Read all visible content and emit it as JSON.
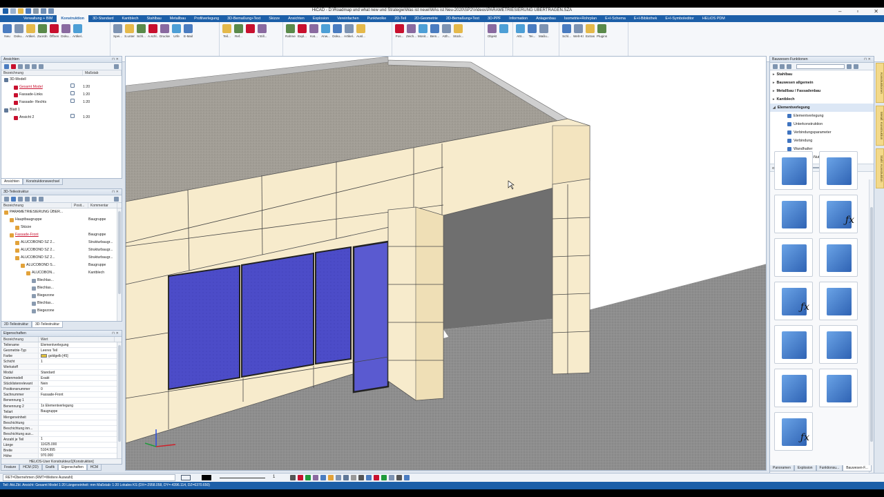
{
  "app": {
    "title": "HiCAD - D:\\Roadmap und what new und Strategie\\Was ist neue\\WAs ist Neu-2020\\SP2\\Videos\\PARAMETRIESIERUNG ÜBERTRAGEN.SZA",
    "accent": "#1c5fa8"
  },
  "menu_tabs": [
    "Verwaltung + BIM",
    "Konstruktion",
    "3D-Standard",
    "Kantblech",
    "Stahlbau",
    "Metallbau",
    "Profilverlegung",
    "3D-Bemaßung+Text",
    "Skizze",
    "Ansichten",
    "Explosion",
    "Vereinfachen",
    "Punktwolke",
    "2D-Teil",
    "2D-Geometrie",
    "2D-Bemaßung+Text",
    "3D-PPF",
    "Information",
    "Anlagenbau",
    "Isometrie+Rohrplan",
    "E+I-Schema",
    "E+I-Bibliothek",
    "E+I-Symboleditor",
    "HELiOS PDM"
  ],
  "active_tab": "Konstruktion",
  "ribbon_groups": [
    {
      "name": "Neu/Öffnen",
      "buttons": [
        "Neu",
        "Doku...",
        "Artikel...",
        "Zuordn...",
        "Öffnen",
        "Doku...",
        "Artikel..."
      ]
    },
    {
      "name": "Speichern/Drucken",
      "buttons": [
        "Spei...",
        "S.unter",
        "Schl...",
        "A.schl...",
        "Drucken",
        "Urfe",
        "E-Mail"
      ]
    },
    {
      "name": "Speichern/Referenzieren",
      "buttons": [
        "Teil...",
        "Ref...",
        "",
        "V.Eill..."
      ]
    },
    {
      "name": "Teil einfügen",
      "buttons": [
        "Rahmen",
        "Expl...",
        "Kat...",
        "Anw...",
        "Doku...",
        "Artikel...",
        "Ausl..."
      ]
    },
    {
      "name": "Positionierung/Detaillierung",
      "buttons": [
        "Pos...",
        "Zeich...",
        "Monit...",
        "Bem...",
        "Atth...",
        "Stück..."
      ]
    },
    {
      "name": "Löschen",
      "buttons": [
        "Objekt",
        ""
      ]
    },
    {
      "name": "Eigenschaften",
      "buttons": [
        "Attr...",
        "Tei...",
        "Maßu..."
      ]
    },
    {
      "name": "Sonstiges",
      "buttons": [
        "Schl...",
        "Welt-KS",
        "Extras",
        "Plugins"
      ]
    }
  ],
  "views_panel": {
    "title": "Ansichten",
    "columns": [
      "Bezeichnung",
      "Maßstab"
    ],
    "rows": [
      {
        "name": "3D-Modell",
        "scale": "",
        "level": 0,
        "red": false
      },
      {
        "name": "Gesamt Model",
        "scale": "1:20",
        "level": 1,
        "red": true
      },
      {
        "name": "Fassade-Links",
        "scale": "1:20",
        "level": 1,
        "red": false
      },
      {
        "name": "Fassade- Rechts",
        "scale": "1:20",
        "level": 1,
        "red": false
      },
      {
        "name": "Blatt 1",
        "scale": "",
        "level": 0,
        "red": false
      },
      {
        "name": "Ansicht 2",
        "scale": "1:20",
        "level": 1,
        "red": false
      }
    ],
    "tabs": [
      "Ansichten",
      "Konstruktionswechsel"
    ]
  },
  "structure_panel": {
    "title": "3D-Teilestruktur",
    "columns": [
      "Bezeichnung",
      "Posit...",
      "Kommentar"
    ],
    "rows": [
      {
        "name": "PARAMETRIESIERUNG ÜBER...",
        "comment": "",
        "level": 0,
        "red": false
      },
      {
        "name": "Hauptbaugruppe",
        "comment": "Baugruppe",
        "level": 1,
        "red": false
      },
      {
        "name": "Skizze",
        "comment": "",
        "level": 2,
        "red": false
      },
      {
        "name": "Fassade-Front",
        "comment": "Baugruppe",
        "level": 1,
        "red": true
      },
      {
        "name": "ALUCOBOND SZ 2...",
        "comment": "Strukturbaugr...",
        "level": 2,
        "red": false
      },
      {
        "name": "ALUCOBOND SZ 2...",
        "comment": "Strukturbaugr...",
        "level": 2,
        "red": false
      },
      {
        "name": "ALUCOBOND SZ 2...",
        "comment": "Strukturbaugr...",
        "level": 2,
        "red": false
      },
      {
        "name": "ALUCOBOND S...",
        "comment": "Baugruppe",
        "level": 3,
        "red": false
      },
      {
        "name": "ALUCOBON...",
        "comment": "Kantblech",
        "level": 4,
        "red": false
      },
      {
        "name": "Blechlas...",
        "comment": "",
        "level": 5,
        "red": false
      },
      {
        "name": "Blechlas...",
        "comment": "",
        "level": 5,
        "red": false
      },
      {
        "name": "Biegezone",
        "comment": "",
        "level": 5,
        "red": false
      },
      {
        "name": "Blechlas...",
        "comment": "",
        "level": 5,
        "red": false
      },
      {
        "name": "Biegezone",
        "comment": "",
        "level": 5,
        "red": false
      }
    ],
    "tabs": [
      "2D-Teilestruktur",
      "3D-Teilestruktur"
    ]
  },
  "properties_panel": {
    "title": "Eigenschaften",
    "columns": [
      "Bezeichnung",
      "Wert"
    ],
    "rows": [
      {
        "k": "Teilename",
        "v": "Elementverlegung"
      },
      {
        "k": "Geometrie-Typ",
        "v": "Leeres Teil"
      },
      {
        "k": "Farbe",
        "v": "goldgelb [45]",
        "swatch": "#e2c23a"
      },
      {
        "k": "Schicht",
        "v": "1"
      },
      {
        "k": "Werkstoff",
        "v": ""
      },
      {
        "k": "Modul",
        "v": "Standard"
      },
      {
        "k": "Datenmodell",
        "v": "Exakt"
      },
      {
        "k": "Stücklistenrelevant",
        "v": "Nein"
      },
      {
        "k": "Positionsnummer",
        "v": "0"
      },
      {
        "k": "Sachnummer",
        "v": "Fassade-Front"
      },
      {
        "k": "Benennung 1",
        "v": ""
      },
      {
        "k": "Benennung 2",
        "v": "1x Elementverlegung"
      },
      {
        "k": "Teilart",
        "v": "Baugruppe"
      },
      {
        "k": "Mengeneinheit",
        "v": ""
      },
      {
        "k": "Beschichtung",
        "v": ""
      },
      {
        "k": "Beschichtung inn...",
        "v": ""
      },
      {
        "k": "Beschichtung aus...",
        "v": ""
      },
      {
        "k": "Anzahl je Teil",
        "v": "1"
      },
      {
        "k": "Länge",
        "v": "11625.000"
      },
      {
        "k": "Breite",
        "v": "5104.995"
      },
      {
        "k": "Höhe",
        "v": "970.000"
      }
    ],
    "footer": "HELiOS-User Konstrukteur1[Konstruktion]",
    "tabs": [
      "Feature",
      "HCM (2D)",
      "Grafik",
      "Eigenschaften",
      "HCM"
    ]
  },
  "right_panel": {
    "title": "Bauwesen-Funktionen",
    "tree": [
      {
        "label": "Stahlbau",
        "bold": true,
        "level": 0
      },
      {
        "label": "Bauwesen allgemein",
        "bold": true,
        "level": 0
      },
      {
        "label": "Metallbau / Fassadenbau",
        "bold": true,
        "level": 0
      },
      {
        "label": "Kantblech",
        "bold": true,
        "level": 0
      },
      {
        "label": "Elementverlegung",
        "bold": true,
        "level": 0
      },
      {
        "label": "Elementverlegung",
        "bold": false,
        "level": 1
      },
      {
        "label": "Unterkonstruktion",
        "bold": false,
        "level": 1
      },
      {
        "label": "Verbindungsparameter",
        "bold": false,
        "level": 1
      },
      {
        "label": "Verbindung",
        "bold": false,
        "level": 1
      },
      {
        "label": "Wandhalter",
        "bold": false,
        "level": 1
      },
      {
        "label": "Wandhalter-Nutzung",
        "bold": false,
        "level": 1
      }
    ],
    "size_label": "Größe:",
    "size_value": "Kleine Symbole",
    "size_slider": 0.45,
    "tabs": [
      "Panoramen",
      "Explosion",
      "Funktionsu...",
      "Bauwesen-F..."
    ],
    "side_tabs": [
      "Konstruktionen",
      "Metall: Konstruktion",
      "Stahl: Konstruktion"
    ],
    "tile_icons": [
      "chain-link-icon",
      "chain-link-icon",
      "wall-bracket-icon",
      "wall-bracket-formula-icon",
      "facade-chain-info-icon",
      "facade-chain-info-icon",
      "panel-formula-icon",
      "panel-edit-icon",
      "panel-save-icon",
      "rail-save-icon",
      "panel-grid-icon",
      "panel-grid-edit-icon",
      "panel-formula-doc-icon"
    ]
  },
  "command_bar": {
    "prompt": "RET=Übernehmen (RMT=Weitere Auswahl)",
    "layer_value": "1"
  },
  "status_bar": {
    "text": "Teil: Akt.Zbl.  Ansicht: Gesamt Model 1:20  Längeneinheit: mm  Maßstab: 1:20  Lokales KS (DX=-2958.058, DY=-4396.114, DZ=6370.650)"
  }
}
